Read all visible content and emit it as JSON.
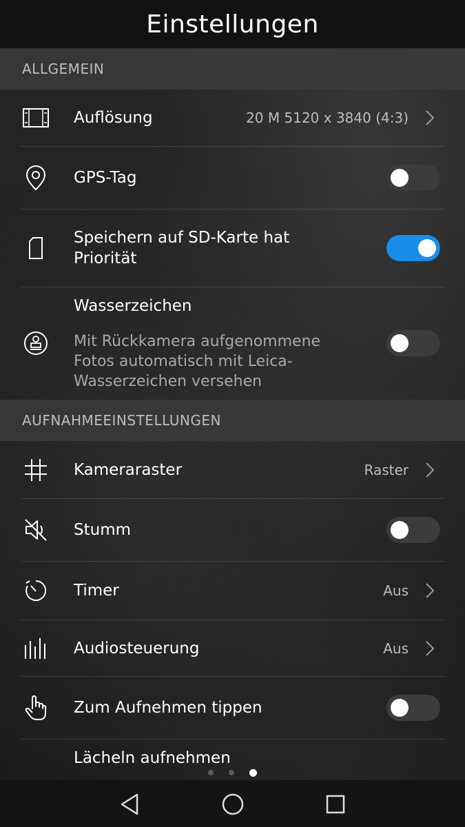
{
  "header": {
    "title": "Einstellungen"
  },
  "sections": {
    "general": "ALLGEMEIN",
    "capture": "AUFNAHMEEINSTELLUNGEN"
  },
  "rows": {
    "resolution": {
      "label": "Auflösung",
      "value": "20 M 5120 x 3840 (4:3)",
      "icon": "resolution-frame-icon"
    },
    "gps": {
      "label": "GPS-Tag",
      "toggle": false,
      "icon": "location-pin-icon"
    },
    "sd": {
      "label_line1": "Speichern auf SD-Karte hat",
      "label_line2": "Priorität",
      "toggle": true,
      "icon": "sd-card-icon"
    },
    "watermark": {
      "label": "Wasserzeichen",
      "desc_line1": "Mit Rückkamera aufgenommene",
      "desc_line2": "Fotos automatisch mit Leica-",
      "desc_line3": "Wasserzeichen versehen",
      "toggle": false,
      "icon": "stamp-icon"
    },
    "grid": {
      "label": "Kameraraster",
      "value": "Raster",
      "icon": "grid-icon"
    },
    "mute": {
      "label": "Stumm",
      "toggle": false,
      "icon": "mute-icon"
    },
    "timer": {
      "label": "Timer",
      "value": "Aus",
      "icon": "timer-icon"
    },
    "audio": {
      "label": "Audiosteuerung",
      "value": "Aus",
      "icon": "audio-control-icon"
    },
    "tap": {
      "label": "Zum Aufnehmen tippen",
      "toggle": false,
      "icon": "tap-hand-icon"
    },
    "smile": {
      "label": "Lächeln aufnehmen"
    }
  },
  "pager": {
    "count": 3,
    "active_index": 2
  },
  "colors": {
    "accent": "#1a8ce8",
    "toggle_off": "#3c3c3c",
    "section_bg": "#3c3c3c"
  }
}
